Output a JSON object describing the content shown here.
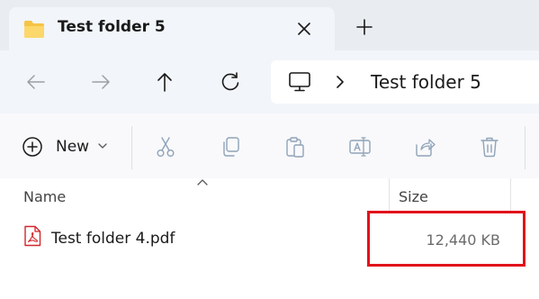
{
  "window": {
    "tab": {
      "title": "Test folder 5",
      "icon": "folder-icon",
      "close_icon": "close-icon"
    },
    "new_tab_icon": "plus-icon"
  },
  "navigation": {
    "back_icon": "arrow-left-icon",
    "forward_icon": "arrow-right-icon",
    "up_icon": "arrow-up-icon",
    "refresh_icon": "refresh-icon",
    "address": {
      "root_icon": "monitor-icon",
      "segments": [
        "Test folder 5"
      ]
    }
  },
  "command_bar": {
    "new_label": "New",
    "icons": [
      "cut-icon",
      "copy-icon",
      "paste-icon",
      "rename-icon",
      "share-icon",
      "delete-icon"
    ]
  },
  "file_list": {
    "columns": [
      "Name",
      "Size"
    ],
    "rows": [
      {
        "name": "Test folder 4.pdf",
        "size": "12,440 KB",
        "icon": "pdf-icon"
      }
    ]
  },
  "colors": {
    "accent": "#0067c0",
    "highlight": "#e1121b",
    "pdf": "#d3262c",
    "folder": "#f5c445"
  }
}
